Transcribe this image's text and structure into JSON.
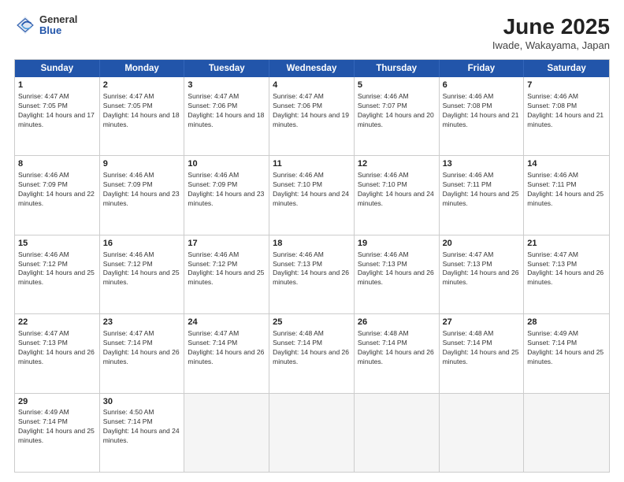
{
  "header": {
    "logo": {
      "general": "General",
      "blue": "Blue"
    },
    "title": "June 2025",
    "subtitle": "Iwade, Wakayama, Japan"
  },
  "calendar": {
    "days_of_week": [
      "Sunday",
      "Monday",
      "Tuesday",
      "Wednesday",
      "Thursday",
      "Friday",
      "Saturday"
    ],
    "weeks": [
      [
        {
          "num": "",
          "empty": true
        },
        {
          "num": "2",
          "rise": "4:47 AM",
          "set": "7:05 PM",
          "daylight": "14 hours and 18 minutes."
        },
        {
          "num": "3",
          "rise": "4:47 AM",
          "set": "7:06 PM",
          "daylight": "14 hours and 18 minutes."
        },
        {
          "num": "4",
          "rise": "4:47 AM",
          "set": "7:06 PM",
          "daylight": "14 hours and 19 minutes."
        },
        {
          "num": "5",
          "rise": "4:46 AM",
          "set": "7:07 PM",
          "daylight": "14 hours and 20 minutes."
        },
        {
          "num": "6",
          "rise": "4:46 AM",
          "set": "7:08 PM",
          "daylight": "14 hours and 21 minutes."
        },
        {
          "num": "7",
          "rise": "4:46 AM",
          "set": "7:08 PM",
          "daylight": "14 hours and 21 minutes."
        }
      ],
      [
        {
          "num": "1",
          "rise": "4:47 AM",
          "set": "7:05 PM",
          "daylight": "14 hours and 17 minutes.",
          "first": true
        },
        {
          "num": "8",
          "rise": "4:46 AM",
          "set": "7:09 PM",
          "daylight": "14 hours and 22 minutes."
        },
        {
          "num": "9",
          "rise": "4:46 AM",
          "set": "7:09 PM",
          "daylight": "14 hours and 23 minutes."
        },
        {
          "num": "10",
          "rise": "4:46 AM",
          "set": "7:09 PM",
          "daylight": "14 hours and 23 minutes."
        },
        {
          "num": "11",
          "rise": "4:46 AM",
          "set": "7:10 PM",
          "daylight": "14 hours and 24 minutes."
        },
        {
          "num": "12",
          "rise": "4:46 AM",
          "set": "7:10 PM",
          "daylight": "14 hours and 24 minutes."
        },
        {
          "num": "13",
          "rise": "4:46 AM",
          "set": "7:11 PM",
          "daylight": "14 hours and 25 minutes."
        },
        {
          "num": "14",
          "rise": "4:46 AM",
          "set": "7:11 PM",
          "daylight": "14 hours and 25 minutes."
        }
      ],
      [
        {
          "num": "15",
          "rise": "4:46 AM",
          "set": "7:12 PM",
          "daylight": "14 hours and 25 minutes."
        },
        {
          "num": "16",
          "rise": "4:46 AM",
          "set": "7:12 PM",
          "daylight": "14 hours and 25 minutes."
        },
        {
          "num": "17",
          "rise": "4:46 AM",
          "set": "7:12 PM",
          "daylight": "14 hours and 25 minutes."
        },
        {
          "num": "18",
          "rise": "4:46 AM",
          "set": "7:13 PM",
          "daylight": "14 hours and 26 minutes."
        },
        {
          "num": "19",
          "rise": "4:46 AM",
          "set": "7:13 PM",
          "daylight": "14 hours and 26 minutes."
        },
        {
          "num": "20",
          "rise": "4:47 AM",
          "set": "7:13 PM",
          "daylight": "14 hours and 26 minutes."
        },
        {
          "num": "21",
          "rise": "4:47 AM",
          "set": "7:13 PM",
          "daylight": "14 hours and 26 minutes."
        }
      ],
      [
        {
          "num": "22",
          "rise": "4:47 AM",
          "set": "7:13 PM",
          "daylight": "14 hours and 26 minutes."
        },
        {
          "num": "23",
          "rise": "4:47 AM",
          "set": "7:14 PM",
          "daylight": "14 hours and 26 minutes."
        },
        {
          "num": "24",
          "rise": "4:47 AM",
          "set": "7:14 PM",
          "daylight": "14 hours and 26 minutes."
        },
        {
          "num": "25",
          "rise": "4:48 AM",
          "set": "7:14 PM",
          "daylight": "14 hours and 26 minutes."
        },
        {
          "num": "26",
          "rise": "4:48 AM",
          "set": "7:14 PM",
          "daylight": "14 hours and 26 minutes."
        },
        {
          "num": "27",
          "rise": "4:48 AM",
          "set": "7:14 PM",
          "daylight": "14 hours and 25 minutes."
        },
        {
          "num": "28",
          "rise": "4:49 AM",
          "set": "7:14 PM",
          "daylight": "14 hours and 25 minutes."
        }
      ],
      [
        {
          "num": "29",
          "rise": "4:49 AM",
          "set": "7:14 PM",
          "daylight": "14 hours and 25 minutes."
        },
        {
          "num": "30",
          "rise": "4:50 AM",
          "set": "7:14 PM",
          "daylight": "14 hours and 24 minutes."
        },
        {
          "num": "",
          "empty": true
        },
        {
          "num": "",
          "empty": true
        },
        {
          "num": "",
          "empty": true
        },
        {
          "num": "",
          "empty": true
        },
        {
          "num": "",
          "empty": true
        }
      ]
    ]
  }
}
